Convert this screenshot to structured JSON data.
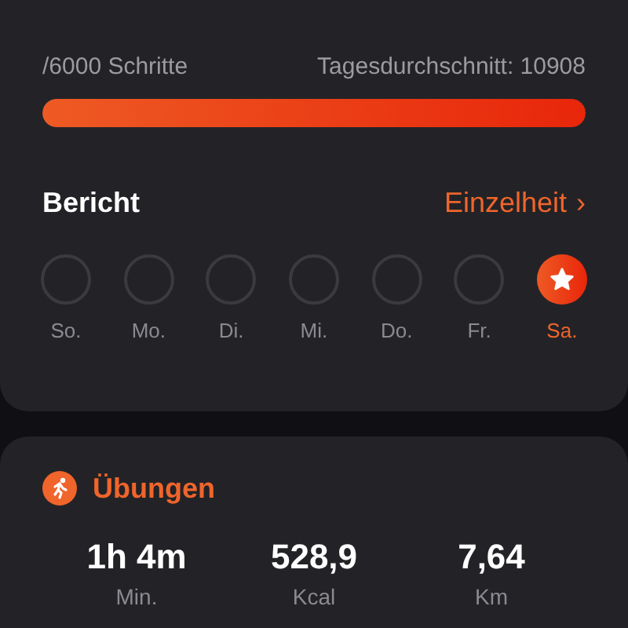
{
  "steps": {
    "goal": "/6000 Schritte",
    "average": "Tagesdurchschnitt: 10908",
    "level": 1
  },
  "report": {
    "title": "Bericht",
    "link": "Einzelheit",
    "link_icon": "›",
    "days": [
      {
        "label": "So.",
        "selected": false
      },
      {
        "label": "Mo.",
        "selected": false
      },
      {
        "label": "Di.",
        "selected": false
      },
      {
        "label": "Mi.",
        "selected": false
      },
      {
        "label": "Do.",
        "selected": false
      },
      {
        "label": "Fr.",
        "selected": false
      },
      {
        "label": "Sa.",
        "selected": true
      }
    ]
  },
  "exercise": {
    "title": "Übungen",
    "stats": [
      {
        "value": "1h 4m",
        "unit": "Min."
      },
      {
        "value": "528,9",
        "unit": "Kcal"
      },
      {
        "value": "7,64",
        "unit": "Km"
      }
    ]
  }
}
